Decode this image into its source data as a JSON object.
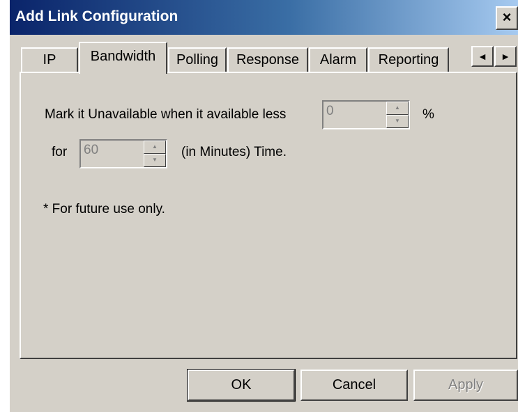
{
  "window": {
    "title": "Add Link Configuration",
    "close_glyph": "×"
  },
  "tabs": [
    {
      "label": "IP",
      "active": false
    },
    {
      "label": "Bandwidth",
      "active": true
    },
    {
      "label": "Polling",
      "active": false
    },
    {
      "label": "Response",
      "active": false
    },
    {
      "label": "Alarm",
      "active": false
    },
    {
      "label": "Reporting",
      "active": false
    }
  ],
  "tab_scroll": {
    "left_glyph": "◄",
    "right_glyph": "►"
  },
  "bandwidth": {
    "unavailable_label": "Mark it Unavailable when it available less",
    "unavailable_value": "0",
    "percent_label": "%",
    "for_label": "for",
    "time_value": "60",
    "time_unit_label": "(in Minutes) Time.",
    "footnote": "* For future use only."
  },
  "spinner": {
    "up_glyph": "▲",
    "down_glyph": "▼"
  },
  "buttons": {
    "ok": "OK",
    "cancel": "Cancel",
    "apply": "Apply"
  },
  "colors": {
    "title_gradient_start": "#0a246a",
    "title_gradient_end": "#a6caf0",
    "dialog_face": "#d4d0c8"
  }
}
